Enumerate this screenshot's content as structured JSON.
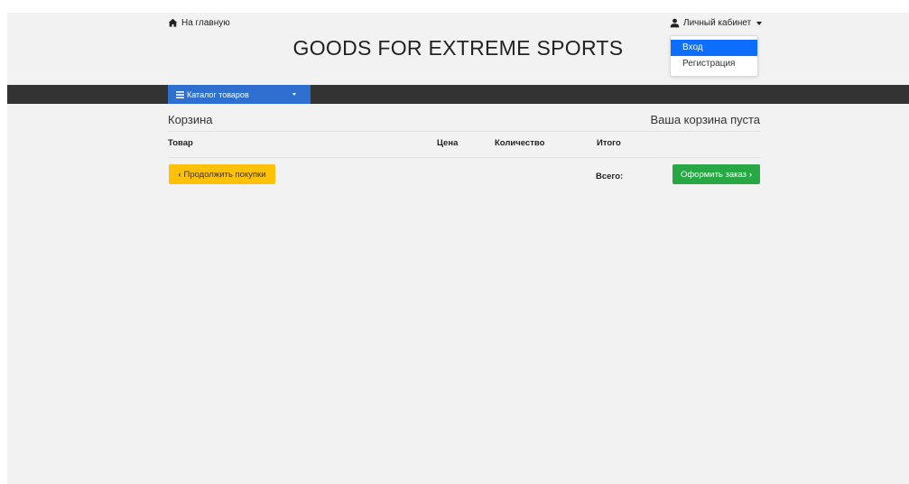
{
  "header": {
    "home_link": "На главную",
    "brand": "GOODS FOR EXTREME SPORTS",
    "account_label": "Личный кабинет",
    "dropdown": [
      {
        "label": "Вход",
        "active": true
      },
      {
        "label": "Регистрация",
        "active": false
      }
    ]
  },
  "nav": {
    "catalog_label": "Каталог товаров"
  },
  "cart": {
    "title": "Корзина",
    "empty_text": "Ваша корзина пуста",
    "columns": [
      "Товар",
      "Цена",
      "Количество",
      "Итого"
    ],
    "continue_label": "Продолжить покупки",
    "total_label": "Всего:",
    "checkout_label": "Оформить заказ"
  },
  "colors": {
    "navbar": "#333333",
    "catalog_button": "#2f6fd0",
    "continue_button": "#ffc107",
    "checkout_button": "#28a745",
    "dropdown_active": "#0d6efd"
  },
  "icons": {
    "home": "home-icon",
    "user": "user-icon",
    "catalog": "bars-icon"
  }
}
